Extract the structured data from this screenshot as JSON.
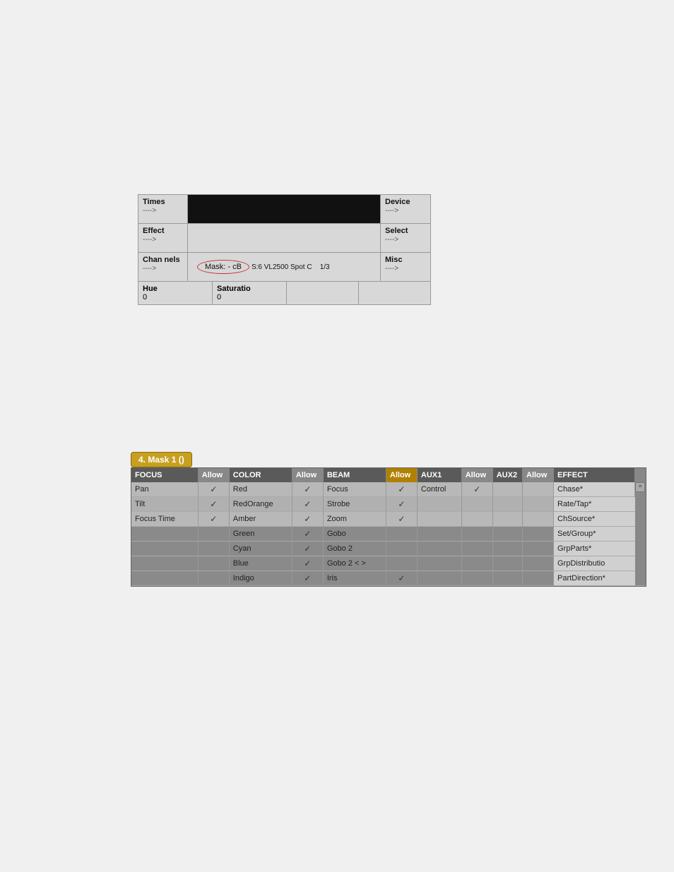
{
  "page": {
    "background": "#f0f0f0"
  },
  "top_panel": {
    "row1": {
      "times_label": "Times",
      "times_arrow": "---->",
      "device_label": "Device",
      "device_arrow": "---->"
    },
    "row2": {
      "effect_label": "Effect",
      "effect_arrow": "---->",
      "select_label": "Select",
      "select_arrow": "---->"
    },
    "row3": {
      "channels_label": "Chan nels",
      "channels_arrow": "---->",
      "mask_label": "Mask: - cB",
      "device_info": "S:6    VL2500  Spot C",
      "page_info": "1/3",
      "misc_label": "Misc",
      "misc_arrow": "---->"
    },
    "row4": {
      "hue_label": "Hue",
      "hue_value": "0",
      "sat_label": "Saturatio",
      "sat_value": "0"
    }
  },
  "bottom_panel": {
    "title": "4. Mask 1 ()",
    "columns": {
      "focus": "FOCUS",
      "allow1": "Allow",
      "color": "COLOR",
      "allow2": "Allow",
      "beam": "BEAM",
      "allow3": "Allow",
      "aux1": "AUX1",
      "allow4": "Allow",
      "aux2": "AUX2",
      "allow5": "Allow",
      "effect": "EFFECT"
    },
    "rows": [
      {
        "focus": "Pan",
        "f_allow": true,
        "color": "Red",
        "c_allow": true,
        "beam": "Focus",
        "b_allow": true,
        "aux1": "Control",
        "a1_allow": true,
        "aux2": "",
        "a2_allow": false,
        "effect": "Chase*",
        "gray": false
      },
      {
        "focus": "Tilt",
        "f_allow": true,
        "color": "RedOrange",
        "c_allow": true,
        "beam": "Strobe",
        "b_allow": true,
        "aux1": "",
        "a1_allow": false,
        "aux2": "",
        "a2_allow": false,
        "effect": "Rate/Tap*",
        "gray": false
      },
      {
        "focus": "Focus Time",
        "f_allow": true,
        "color": "Amber",
        "c_allow": true,
        "beam": "Zoom",
        "b_allow": true,
        "aux1": "",
        "a1_allow": false,
        "aux2": "",
        "a2_allow": false,
        "effect": "ChSource*",
        "gray": false
      },
      {
        "focus": "",
        "f_allow": false,
        "color": "Green",
        "c_allow": true,
        "beam": "Gobo",
        "b_allow": false,
        "aux1": "",
        "a1_allow": false,
        "aux2": "",
        "a2_allow": false,
        "effect": "Set/Group*",
        "gray": true
      },
      {
        "focus": "",
        "f_allow": false,
        "color": "Cyan",
        "c_allow": true,
        "beam": "Gobo 2",
        "b_allow": false,
        "aux1": "",
        "a1_allow": false,
        "aux2": "",
        "a2_allow": false,
        "effect": "GrpParts*",
        "gray": true
      },
      {
        "focus": "",
        "f_allow": false,
        "color": "Blue",
        "c_allow": true,
        "beam": "Gobo 2 < >",
        "b_allow": false,
        "aux1": "",
        "a1_allow": false,
        "aux2": "",
        "a2_allow": false,
        "effect": "GrpDistributio",
        "gray": true
      },
      {
        "focus": "",
        "f_allow": false,
        "color": "Indigo",
        "c_allow": true,
        "beam": "Iris",
        "b_allow": true,
        "aux1": "",
        "a1_allow": false,
        "aux2": "",
        "a2_allow": false,
        "effect": "PartDirection*",
        "gray": true
      }
    ]
  }
}
